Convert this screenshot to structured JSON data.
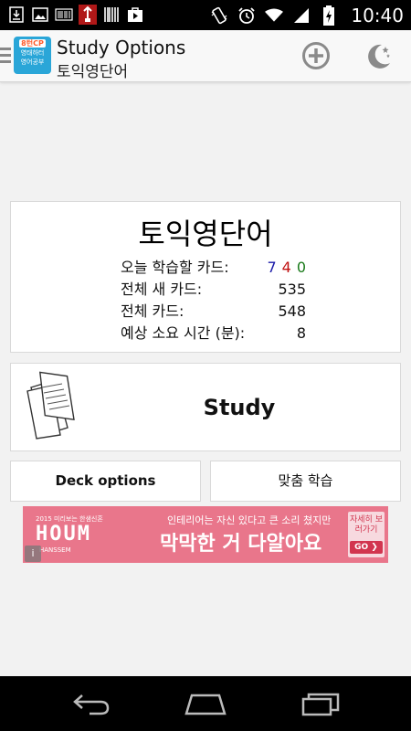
{
  "status_bar": {
    "time": "10:40",
    "icons": [
      "download-icon",
      "image-icon",
      "barcode-reader-icon",
      "app-notification-icon",
      "barcode-icon",
      "play-store-icon",
      "vibrate-icon",
      "alarm-icon",
      "wifi-icon",
      "signal-icon",
      "battery-charging-icon"
    ]
  },
  "action_bar": {
    "logo": {
      "line1": "8턴CP",
      "line2": "영태하터",
      "line3": "영어공부"
    },
    "title": "Study Options",
    "subtitle": "토익영단어",
    "add_icon": "add-circle-icon",
    "night_icon": "night-mode-icon"
  },
  "deck": {
    "name": "토익영단어",
    "today_label": "오늘 학습할 카드:",
    "today_new": "7",
    "today_learning": "4",
    "today_review": "0",
    "new_total_label": "전체 새 카드:",
    "new_total": "535",
    "total_label": "전체 카드:",
    "total": "548",
    "eta_label": "예상 소요 시간 (분):",
    "eta": "8"
  },
  "study": {
    "label": "Study",
    "icon": "cards-icon"
  },
  "buttons": {
    "deck_options": "Deck options",
    "custom_study": "맞춤 학습"
  },
  "ad": {
    "year_text": "2015 미리보는 한샘신혼",
    "brand": "HOUM",
    "company": "HANSSEM",
    "line1": "인테리어는 자신 있다고 큰 소리 쳤지만",
    "line2": "막막한 거 다알아요",
    "cta": "자세히 보러가기",
    "cta_go": "GO ❯",
    "info_icon": "info-icon"
  },
  "nav_bar": {
    "icons": [
      "back-icon",
      "home-icon",
      "recents-icon"
    ]
  },
  "colors": {
    "new": "#1a1aa8",
    "learning": "#c01010",
    "review": "#1a7a1a",
    "ad_background": "#e9768b",
    "logo_background": "#2aa6d8"
  }
}
